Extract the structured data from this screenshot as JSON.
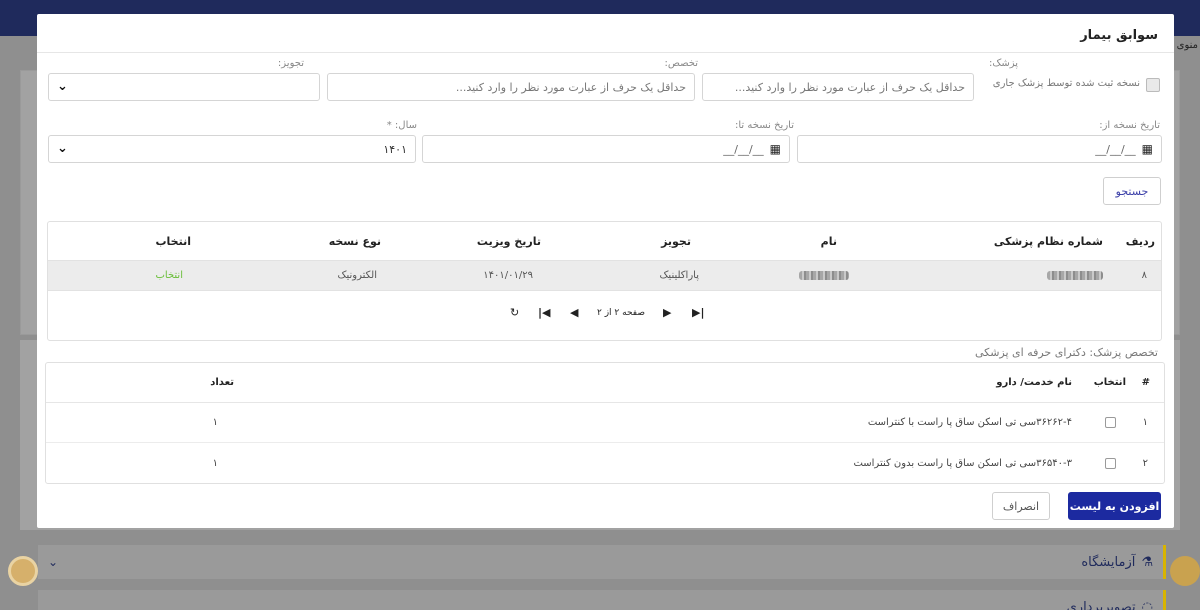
{
  "background": {
    "side_label": "منوی",
    "rows": [
      {
        "label": "آزمایشگاه",
        "icon": "flask-icon",
        "chevron": "chevron-down-icon"
      },
      {
        "label": "تصویربرداری",
        "icon": "lamp-icon"
      }
    ]
  },
  "modal": {
    "title": "سوابق بیمار",
    "filters": {
      "current_doctor_checkbox_label": "نسخه ثبت شده توسط پزشک جاری",
      "doctor_label": "پزشک:",
      "doctor_placeholder": "حداقل یک حرف از عبارت مورد نظر را وارد کنید...",
      "specialty_label": "تخصص:",
      "specialty_placeholder": "حداقل یک حرف از عبارت مورد نظر را وارد کنید...",
      "prescription_label": "تجویز:",
      "prescription_value": "",
      "date_from_label": "تاریخ نسخه از:",
      "date_from_value": "__/__/__",
      "date_to_label": "تاریخ نسخه تا:",
      "date_to_value": "__/__/__",
      "year_label": "سال: *",
      "year_value": "۱۴۰۱"
    },
    "search_label": "جستجو",
    "visits_table": {
      "headers": [
        "ردیف",
        "شماره نظام پزشکی",
        "نام",
        "تجویز",
        "تاریخ ویزیت",
        "نوع نسخه",
        "انتخاب"
      ],
      "rows": [
        {
          "index": "۸",
          "license": "",
          "name": "",
          "prescription": "پاراکلینیک",
          "date": "۱۴۰۱/۰۱/۲۹",
          "type": "الکترونیک",
          "select": "انتخاب"
        }
      ],
      "pager": {
        "page_text": "صفحه ۲ از ۲"
      }
    },
    "specialty_line": {
      "label": "تخصص پزشک:",
      "value": "دکترای حرفه ای پزشکی"
    },
    "services_table": {
      "headers": {
        "num": "#",
        "select": "انتخاب",
        "name": "نام خدمت/ دارو",
        "count": "تعداد"
      },
      "rows": [
        {
          "num": "۱",
          "name": "۳۶۲۶۲-۴سی تی اسکن ساق پا راست با کنتراست",
          "count": "۱"
        },
        {
          "num": "۲",
          "name": "۳۶۵۴۰-۳سی تی اسکن ساق پا راست بدون کنتراست",
          "count": "۱"
        }
      ]
    },
    "cancel_label": "انصراف",
    "add_label": "افزودن به لیست"
  },
  "colors": {
    "primary": "#1c2aa0",
    "select_green": "#6abf3a",
    "accent_yellow": "#d8b400"
  }
}
